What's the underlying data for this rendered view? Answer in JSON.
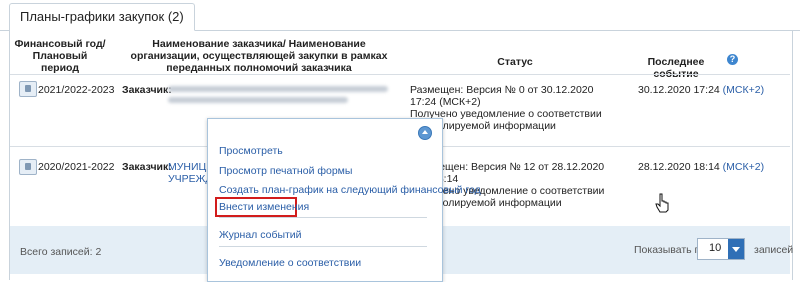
{
  "tab": {
    "label": "Планы-графики закупок (2)"
  },
  "columns": [
    "Финансовый год/ Плановый период",
    "Наименование заказчика/ Наименование организации, осуществляющей закупки в рамках переданных полномочий заказчика",
    "Статус",
    "Последнее событие"
  ],
  "help_icon": "?",
  "rows": [
    {
      "period": "2021/2022-2023",
      "customer_label": "Заказчик:",
      "status_line1": "Размещен: Версия № 0 от 30.12.2020 17:24 (МСК+2)",
      "status_line2": "Получено уведомление о соответствии контролируемой информации",
      "event_date": "30.12.2020 17:24",
      "event_tz": "(МСК+2)"
    },
    {
      "period": "2020/2021-2022",
      "customer_label": "Заказчик:",
      "customer_name_line1": "МУНИЦИП",
      "customer_name_line2": "УЧРЕЖДЕН",
      "status_line1": "мещен: Версия № 12 от 28.12.2020 18:14",
      "status_line2": "учено уведомление о соответствии",
      "status_line3": "тролируемой информации",
      "event_date": "28.12.2020 18:14",
      "event_tz": "(МСК+2)"
    }
  ],
  "menu": {
    "items": [
      "Просмотреть",
      "Просмотр печатной формы",
      "Создать план-график на следующий финансовый год",
      "Внести изменения",
      "Журнал событий",
      "Уведомление о соответствии"
    ]
  },
  "footer": {
    "total": "Всего записей: 2",
    "per_page_label": "Показывать по",
    "per_page_value": "10",
    "records_label": "записей"
  },
  "colors": {
    "link": "#2a5ea7",
    "highlight": "#d21c1c",
    "footer_bg": "#e4eef6"
  }
}
